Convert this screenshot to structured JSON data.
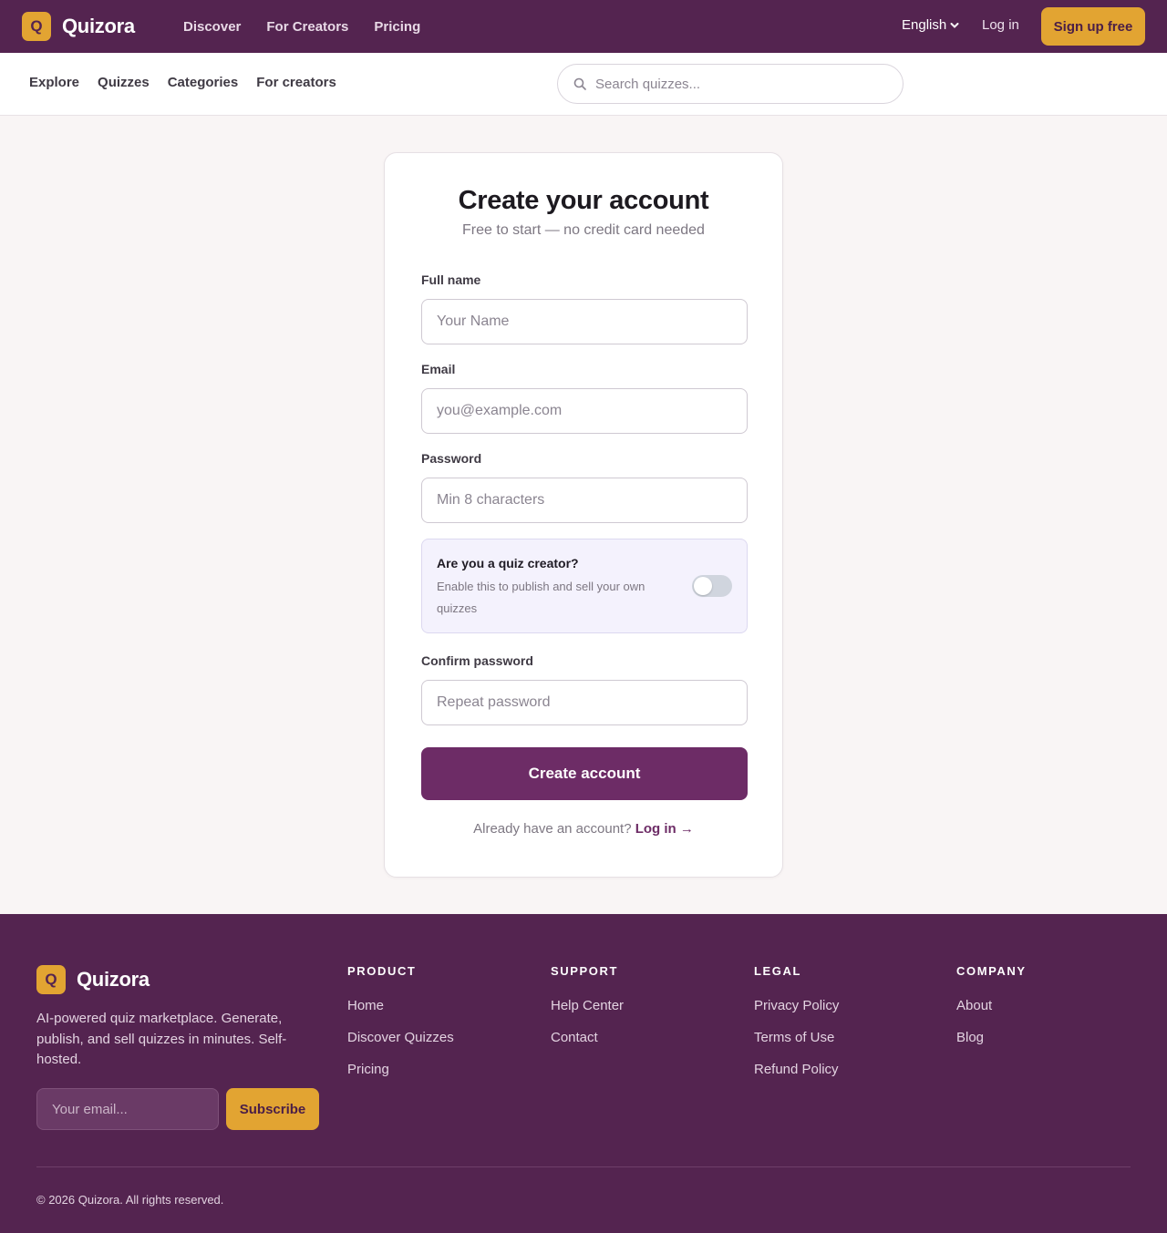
{
  "brand": {
    "name": "Quizora",
    "badge_letter": "Q",
    "accent": "#e2a432",
    "primary": "#542450"
  },
  "topnav": {
    "items": [
      "Discover",
      "For Creators",
      "Pricing"
    ],
    "language": "English",
    "login": "Log in",
    "signup": "Sign up free"
  },
  "subnav": {
    "items": [
      "Explore",
      "Quizzes",
      "Categories",
      "For creators"
    ],
    "search_placeholder": "Search quizzes..."
  },
  "form": {
    "title": "Create your account",
    "subtitle": "Free to start — no credit card needed",
    "name_label": "Full name",
    "name_placeholder": "Your Name",
    "email_label": "Email",
    "email_placeholder": "you@example.com",
    "password_label": "Password",
    "password_placeholder": "Min 8 characters",
    "creator_title": "Are you a quiz creator?",
    "creator_desc": "Enable this to publish and sell your own quizzes",
    "creator_enabled": false,
    "confirm_label": "Confirm password",
    "confirm_placeholder": "Repeat password",
    "submit": "Create account",
    "have_account": "Already have an account?",
    "login_link": "Log in →"
  },
  "footer": {
    "about": "AI-powered quiz marketplace. Generate, publish, and sell quizzes in minutes. Self-hosted.",
    "email_placeholder": "Your email...",
    "subscribe": "Subscribe",
    "columns": [
      {
        "title": "PRODUCT",
        "links": [
          "Home",
          "Discover Quizzes",
          "Pricing"
        ]
      },
      {
        "title": "SUPPORT",
        "links": [
          "Help Center",
          "Contact"
        ]
      },
      {
        "title": "LEGAL",
        "links": [
          "Privacy Policy",
          "Terms of Use",
          "Refund Policy"
        ]
      },
      {
        "title": "COMPANY",
        "links": [
          "About",
          "Blog"
        ]
      }
    ],
    "copyright": "© 2026 Quizora. All rights reserved."
  }
}
